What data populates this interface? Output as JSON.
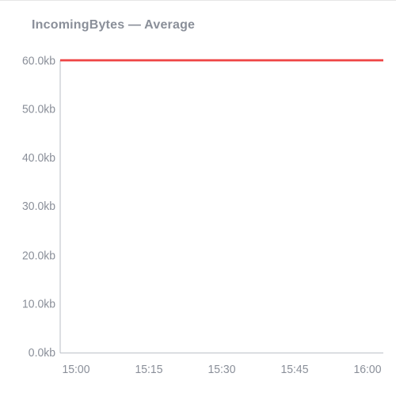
{
  "title": "IncomingBytes — Average",
  "colors": {
    "series": "#ef4444",
    "axis": "#b9bec6",
    "tick": "#8a8f99"
  },
  "chart_data": {
    "type": "line",
    "title": "IncomingBytes — Average",
    "xlabel": "",
    "ylabel": "",
    "x_ticks": [
      "15:00",
      "15:15",
      "15:30",
      "15:45",
      "16:00"
    ],
    "y_ticks": [
      "0.0kb",
      "10.0kb",
      "20.0kb",
      "30.0kb",
      "40.0kb",
      "50.0kb",
      "60.0kb"
    ],
    "ylim": [
      0,
      60
    ],
    "series": [
      {
        "name": "IncomingBytes Average",
        "x": [
          "15:00",
          "15:15",
          "15:30",
          "15:45",
          "16:00"
        ],
        "values": [
          60,
          60,
          60,
          60,
          60
        ]
      }
    ]
  }
}
